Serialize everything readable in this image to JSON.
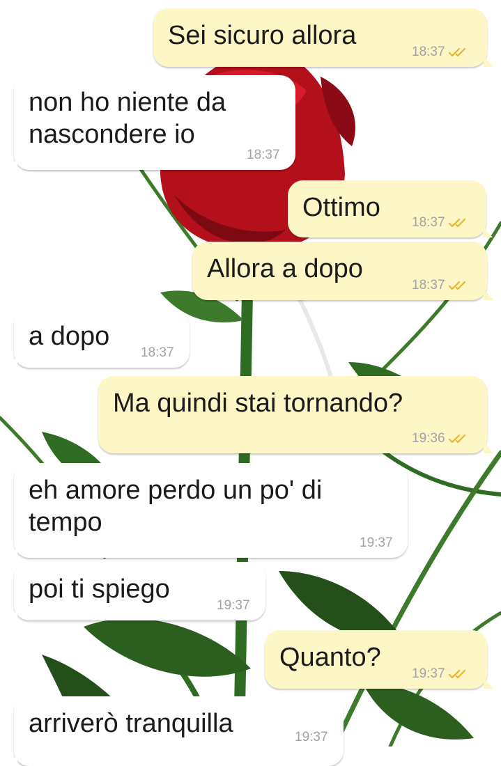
{
  "messages": [
    {
      "dir": "out",
      "text": "Sei sicuro allora",
      "time": "18:37"
    },
    {
      "dir": "in",
      "text": "non ho niente da\nnascondere io",
      "time": "18:37"
    },
    {
      "dir": "out",
      "text": "Ottimo",
      "time": "18:37"
    },
    {
      "dir": "out",
      "text": "Allora a dopo",
      "time": "18:37"
    },
    {
      "dir": "in",
      "text": "a dopo",
      "time": "18:37"
    },
    {
      "dir": "out",
      "text": "Ma quindi stai tornando?",
      "time": "19:36"
    },
    {
      "dir": "in",
      "text": "eh amore perdo un po' di\ntempo",
      "time": "19:37"
    },
    {
      "dir": "in",
      "text": "poi ti spiego",
      "time": "19:37"
    },
    {
      "dir": "out",
      "text": "Quanto?",
      "time": "19:37"
    },
    {
      "dir": "in",
      "text": "arriverò tranquilla",
      "time": "19:37"
    }
  ],
  "colors": {
    "outgoing_bubble": "#fdf6c6",
    "incoming_bubble": "#ffffff",
    "read_ticks": "#e8b631",
    "timestamp": "#a2a2a2"
  },
  "icons": {
    "read_receipt": "double-check-icon",
    "wallpaper": "red-rose-wallpaper"
  }
}
